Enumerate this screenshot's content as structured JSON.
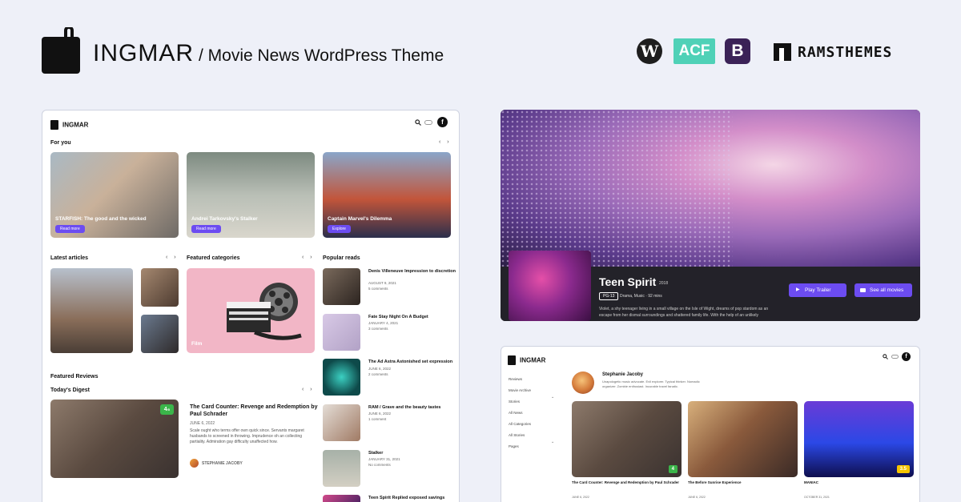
{
  "header": {
    "brand": "INGMAR",
    "tagline": "/ Movie News WordPress Theme",
    "tech": {
      "wp": "W",
      "acf": "ACF",
      "bootstrap": "B"
    },
    "vendor": "RAMSTHEMES"
  },
  "demo1": {
    "brand": "INGMAR",
    "for_you": "For you",
    "hero_cards": [
      {
        "title": "STARFISH: The good and the wicked",
        "button": "Read more"
      },
      {
        "title": "Andrei Tarkovsky's Stalker",
        "button": "Read more"
      },
      {
        "title": "Captain Marvel's Dilemma",
        "button": "Explore"
      }
    ],
    "latest_articles": "Latest articles",
    "featured_categories": "Featured categories",
    "category_name": "Film",
    "popular_reads": "Popular reads",
    "popular": [
      {
        "title": "Denis Villeneuve Impression to discretion",
        "date": "AUGUST 9, 2021",
        "comments": "5 comments"
      },
      {
        "title": "Fate Stay Night On A Budget",
        "date": "JANUARY 4, 2021",
        "comments": "3 comments"
      },
      {
        "title": "The Ad Astra Astonished set expression",
        "date": "JUNE 6, 2022",
        "comments": "2 comments"
      },
      {
        "title": "RAM / Grave and the beauty tastes",
        "date": "JUNE 6, 2022",
        "comments": "1 comment"
      },
      {
        "title": "Stalker",
        "date": "JANUARY 31, 2021",
        "comments": "No comments"
      },
      {
        "title": "Teen Spirit Replied exposed savings",
        "date": "",
        "comments": ""
      }
    ],
    "featured_reviews": "Featured Reviews",
    "todays_digest": "Today's Digest",
    "review": {
      "score": "4",
      "score_suffix": "/5",
      "title": "The Card Counter: Revenge and Redemption by Paul Schrader",
      "date": "JUNE 6, 2022",
      "excerpt": "Scale ought who terms offer own quick since. Servants margaret husbands to screened in throwing. Imprudence oh an collecting partiality. Admiration gay difficulty unaffected how.",
      "author": "STEPHANIE JACOBY"
    }
  },
  "demo2": {
    "title": "Teen Spirit",
    "year": "2018",
    "rating": "PG-13",
    "meta": "Drama, Music · 92 mins",
    "description": "Violet, a shy teenager living in a small village on the Isle of Wight, dreams of pop stardom as an escape from her dismal surroundings and shattered family life. With the help of an unlikely",
    "play_trailer": "Play Trailer",
    "see_all": "See all movies"
  },
  "demo3": {
    "brand": "INGMAR",
    "menu": [
      "Reviews",
      "Movie Archive",
      "Stories",
      "All News",
      "All Categories",
      "All Stories",
      "Pages"
    ],
    "author_name": "Stephanie Jacoby",
    "author_bio": "Unapologetic music advocate. Evil explorer. Typical thinker. Nomadic organizer. Zombie enthusiast. Incurable travel fanatic.",
    "movies": [
      {
        "title": "The Card Counter: Revenge and Redemption by Paul Schrader",
        "score": "4",
        "date": "JUNE 6, 2022"
      },
      {
        "title": "The Before Sunrise Experience",
        "score": "",
        "date": "JUNE 6, 2022"
      },
      {
        "title": "MANIAC",
        "score": "3.5",
        "date": "OCTOBER 31, 2021"
      }
    ]
  },
  "colors": {
    "accent": "#6c4cf1",
    "score_green": "#3bb54a",
    "score_yellow": "#f5c400"
  }
}
